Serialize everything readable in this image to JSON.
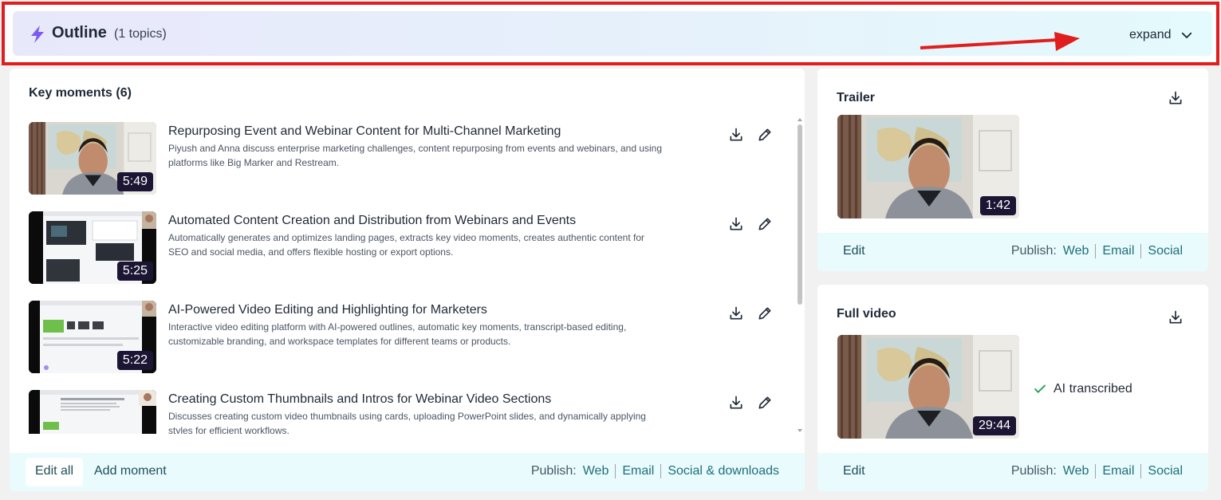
{
  "outline": {
    "title": "Outline",
    "count": "(1 topics)",
    "expand_label": "expand"
  },
  "key_moments": {
    "title": "Key moments (6)",
    "items": [
      {
        "title": "Repurposing Event and Webinar Content for Multi-Channel Marketing",
        "description": "Piyush and Anna discuss enterprise marketing challenges, content repurposing from events and webinars, and using platforms like Big Marker and Restream.",
        "duration": "5:49",
        "thumb": "webcam"
      },
      {
        "title": "Automated Content Creation and Distribution from Webinars and Events",
        "description": "Automatically generates and optimizes landing pages, extracts key video moments, creates authentic content for SEO and social media, and offers flexible hosting or export options.",
        "duration": "5:25",
        "thumb": "screen-dark"
      },
      {
        "title": "AI-Powered Video Editing and Highlighting for Marketers",
        "description": "Interactive video editing platform with AI-powered outlines, automatic key moments, transcript-based editing, customizable branding, and workspace templates for different teams or products.",
        "duration": "5:22",
        "thumb": "screen-green"
      },
      {
        "title": "Creating Custom Thumbnails and Intros for Webinar Video Sections",
        "description": "Discusses creating custom video thumbnails using cards, uploading PowerPoint slides, and dynamically applying styles for efficient workflows.",
        "duration": "",
        "thumb": "screen-doc"
      }
    ],
    "footer": {
      "edit_all": "Edit all",
      "add_moment": "Add moment",
      "publish_label": "Publish:",
      "links": [
        "Web",
        "Email",
        "Social & downloads"
      ]
    }
  },
  "trailer": {
    "title": "Trailer",
    "duration": "1:42",
    "edit_label": "Edit",
    "publish_label": "Publish:",
    "links": [
      "Web",
      "Email",
      "Social"
    ]
  },
  "full_video": {
    "title": "Full video",
    "duration": "29:44",
    "status": "AI transcribed",
    "edit_label": "Edit",
    "publish_label": "Publish:",
    "links": [
      "Web",
      "Email",
      "Social"
    ]
  },
  "colors": {
    "annotation_red": "#e01e1e",
    "accent_purple": "#7c5cf0",
    "link_teal": "#1f6f7a",
    "footer_bg": "#e9fbfd",
    "check_green": "#16a34a",
    "duration_bg": "#1c1533"
  },
  "icons": {
    "outline": "lightning-icon",
    "expand": "chevron-down-icon",
    "download": "download-icon",
    "edit": "pencil-icon",
    "status": "check-icon"
  }
}
